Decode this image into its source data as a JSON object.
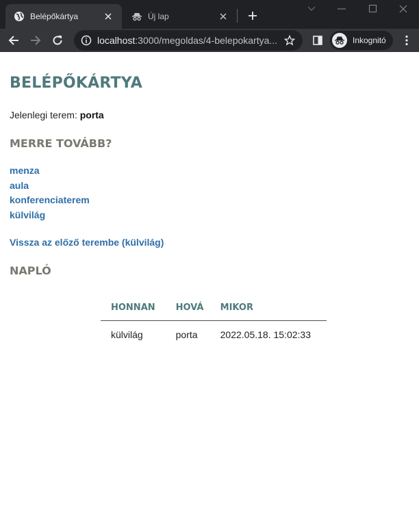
{
  "browser": {
    "tabs": [
      {
        "title": "Belépőkártya",
        "active": true,
        "icon": "globe-icon"
      },
      {
        "title": "Új lap",
        "active": false,
        "icon": "incognito-icon"
      }
    ],
    "url_host": "localhost",
    "url_path": ":3000/megoldas/4-belepokartya...",
    "profile_label": "Inkognitó"
  },
  "page": {
    "title": "BELÉPŐKÁRTYA",
    "current_room_label": "Jelenlegi terem:",
    "current_room": "porta",
    "next_heading": "MERRE TOVÁBB?",
    "rooms": [
      "menza",
      "aula",
      "konferenciaterem",
      "külvilág"
    ],
    "back_link": "Vissza az előző terembe (külvilág)",
    "log_heading": "NAPLÓ",
    "log": {
      "headers": [
        "HONNAN",
        "HOVÁ",
        "MIKOR"
      ],
      "rows": [
        [
          "külvilág",
          "porta",
          "2022.05.18. 15:02:33"
        ]
      ]
    }
  },
  "colors": {
    "accent": "#4f7a7c",
    "heading_gray": "#7a7970",
    "link": "#2f6ea8",
    "chrome_dark": "#202124",
    "chrome_toolbar": "#35363a"
  }
}
